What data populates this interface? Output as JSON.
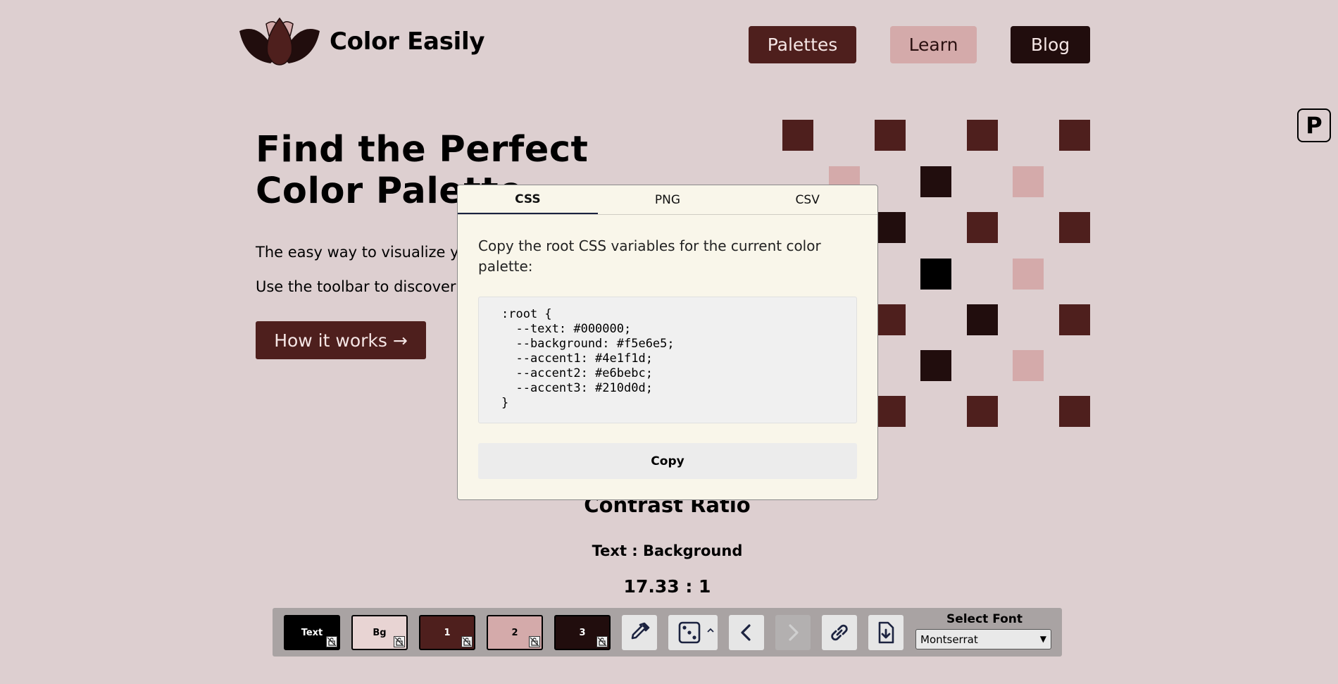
{
  "header": {
    "brand_name": "Color Easily",
    "nav": [
      {
        "label": "Palettes"
      },
      {
        "label": "Learn"
      },
      {
        "label": "Blog"
      }
    ],
    "corner_badge": "P"
  },
  "hero": {
    "title_line1": "Find the Perfect",
    "title_line2": "Color Palette",
    "paragraph1": "The easy way to visualize yo",
    "paragraph2": "Use the toolbar to discover y",
    "button_label": "How it works →"
  },
  "palette": {
    "text": "#000000",
    "background": "#f5e6e5",
    "accent1": "#4e1f1d",
    "accent2": "#e6bebc",
    "accent3": "#210d0d"
  },
  "modal": {
    "tabs": [
      {
        "label": "CSS",
        "active": true
      },
      {
        "label": "PNG",
        "active": false
      },
      {
        "label": "CSV",
        "active": false
      }
    ],
    "description": "Copy the root CSS variables for the current color palette:",
    "code": ":root {\n  --text: #000000;\n  --background: #f5e6e5;\n  --accent1: #4e1f1d;\n  --accent2: #e6bebc;\n  --accent3: #210d0d;\n}",
    "copy_label": "Copy"
  },
  "contrast": {
    "title": "Contrast Ratio",
    "pair": "Text : Background",
    "ratio": "17.33 : 1"
  },
  "toolbar": {
    "swatches": [
      {
        "label": "Text",
        "color": "#000000",
        "text_color": "#ffffff"
      },
      {
        "label": "Bg",
        "color": "#e8d4d3",
        "text_color": "#000000"
      },
      {
        "label": "1",
        "color": "#4e1f1d",
        "text_color": "#ffffff"
      },
      {
        "label": "2",
        "color": "#d4aaaa",
        "text_color": "#000000"
      },
      {
        "label": "3",
        "color": "#210d0d",
        "text_color": "#ffffff"
      }
    ],
    "tools": [
      "eyedropper-icon",
      "dice-icon",
      "chevron-up-icon",
      "undo-chevron-left-icon",
      "redo-chevron-right-icon",
      "link-icon",
      "download-file-icon"
    ],
    "font_label": "Select Font",
    "font_value": "Montserrat"
  }
}
